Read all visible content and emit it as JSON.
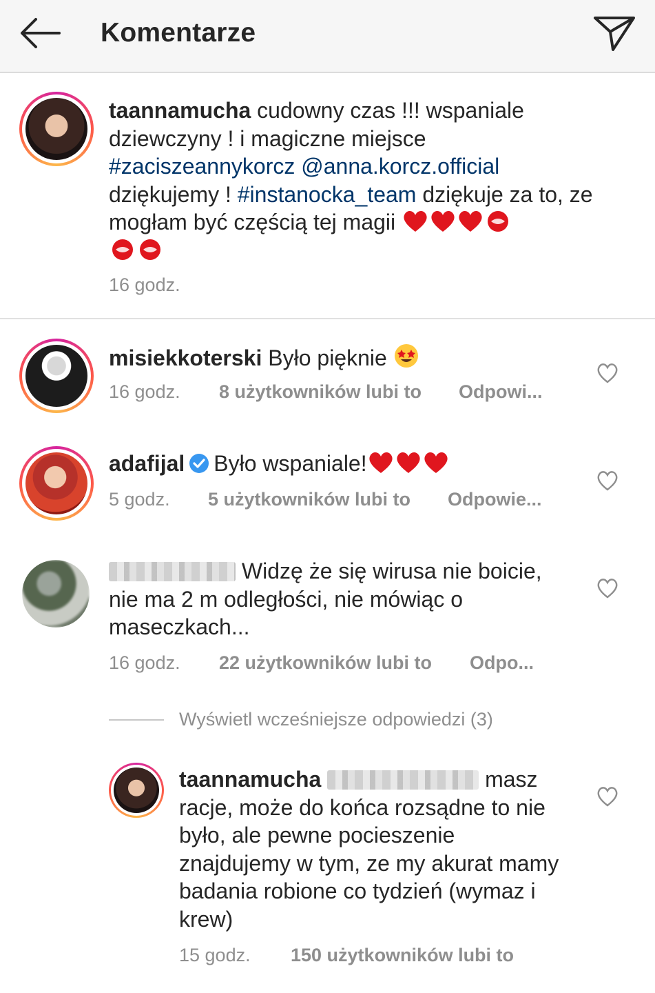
{
  "header": {
    "title": "Komentarze"
  },
  "icons": {
    "back": "arrow-left-icon",
    "send": "paper-plane-icon",
    "like": "heart-outline-icon",
    "verified": "verified-badge-icon"
  },
  "colors": {
    "link": "#003569",
    "meta": "#8e8e8e",
    "verified": "#3897f0",
    "heart_red": "#e0161e"
  },
  "caption": {
    "username": "taannamucha",
    "text_1": " cudowny czas !!! wspaniale dziewczyny ! i magiczne miejsce ",
    "hashtag_1": "#zaciszeannykorcz",
    "mention_1": "@anna.korcz.official",
    "text_2": " dziękujemy ! ",
    "hashtag_2": "#instanocka_team",
    "text_3": " dziękuje za to, ze mogłam być częścią tej magii ",
    "time": "16 godz."
  },
  "comments": [
    {
      "username": "misiekkoterski",
      "text": " Było pięknie ",
      "time": "16 godz.",
      "likes": "8 użytkowników lubi to",
      "reply": "Odpowi..."
    },
    {
      "username": "adafijal",
      "text": "Było wspaniale!",
      "time": "5 godz.",
      "likes": "5 użytkowników lubi to",
      "reply": "Odpowie..."
    },
    {
      "text": " Widzę że się wirusa nie boicie, nie ma 2 m odległości, nie mówiąc o maseczkach...",
      "time": "16 godz.",
      "likes": "22 użytkowników lubi to",
      "reply": "Odpo..."
    }
  ],
  "view_replies": "Wyświetl wcześniejsze odpowiedzi (3)",
  "reply": {
    "username": "taannamucha",
    "text": " masz racje, może do końca rozsądne to nie było, ale pewne pocieszenie znajdujemy w tym, ze my akurat mamy badania robione co tydzień (wymaz i krew)",
    "time": "15 godz.",
    "likes": "150 użytkowników lubi to"
  }
}
